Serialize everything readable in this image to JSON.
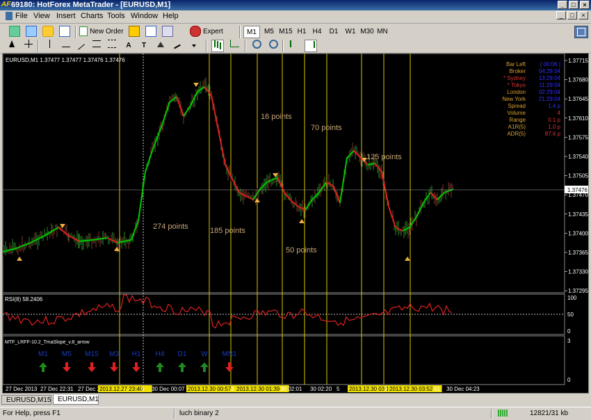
{
  "window": {
    "title": "69180: HotForex MetaTrader - [EURUSD,M1]",
    "logo": "AF",
    "btn_min": "_",
    "btn_max": "□",
    "btn_close": "×"
  },
  "menu": [
    "File",
    "View",
    "Insert",
    "Charts",
    "Tools",
    "Window",
    "Help"
  ],
  "toolbar": {
    "new_order": "New Order",
    "expert_advisors": "Expert Advisors",
    "timeframes": [
      "M1",
      "M5",
      "M15",
      "H1",
      "H4",
      "D1",
      "W1",
      "M30",
      "MN"
    ]
  },
  "drawing_tools": {
    "text": "A",
    "label": "T"
  },
  "chart": {
    "header": "EURUSD,M1  1.37477 1.37477 1.37476 1.37476",
    "current_price": "1.37476",
    "price_ticks": [
      "1.37715",
      "1.37680",
      "1.37645",
      "1.37610",
      "1.37575",
      "1.37540",
      "1.37505",
      "1.37470",
      "1.37435",
      "1.37400",
      "1.37365",
      "1.37330",
      "1.37295"
    ],
    "annotations": [
      "274 points",
      "185 points",
      "16 points",
      "50 points",
      "70 points",
      "125 points"
    ],
    "info_panel": [
      {
        "label": "Bar Left",
        "value": "[ 00:06 ]"
      },
      {
        "label": "Broker",
        "value": "04:29:04"
      },
      {
        "label": "* Sydney",
        "value": "13:29:04"
      },
      {
        "label": "* Tokyo",
        "value": "11:29:04"
      },
      {
        "label": "London",
        "value": "02:29:04"
      },
      {
        "label": "New York",
        "value": "21:29:04"
      },
      {
        "label": "Spread",
        "value": "1.4 p"
      },
      {
        "label": "Volume",
        "value": "4"
      },
      {
        "label": "Range",
        "value": "0.1 p"
      },
      {
        "label": "A1R(5)",
        "value": "1.0 p"
      },
      {
        "label": "ADR(5)",
        "value": "87.6 p"
      }
    ],
    "rsi": {
      "label": "RSI(8) 58.2406",
      "ticks": [
        "100",
        "50",
        "0"
      ]
    },
    "mtf": {
      "label": "MTF_LRFF-10.2_TmaSlope_v.8_arrow",
      "ticks": [
        "3",
        "0"
      ],
      "items": [
        {
          "tf": "M1",
          "dir": "up"
        },
        {
          "tf": "M5",
          "dir": "down"
        },
        {
          "tf": "M15",
          "dir": "down"
        },
        {
          "tf": "M3",
          "dir": "down"
        },
        {
          "tf": "H1",
          "dir": "down"
        },
        {
          "tf": "H4",
          "dir": "up"
        },
        {
          "tf": "D1",
          "dir": "up"
        },
        {
          "tf": "W",
          "dir": "up"
        },
        {
          "tf": "MN1",
          "dir": "down"
        }
      ]
    },
    "time_axis": [
      "27 Dec 2013",
      "27 Dec 22:31",
      "27 Dec 2",
      "2013.12.27 23:40",
      "5",
      "30 Dec 00:07",
      "2013.12.30 00:57",
      "3",
      "2013.12.30 01:39",
      ":30 02:01",
      "30 02:20",
      "5",
      "2013.12.30 03:10",
      "3",
      "2013.12.30 03:52",
      ":51",
      "30 Dec 04:23"
    ]
  },
  "tabs": [
    "EURUSD,M15",
    "EURUSD,M1"
  ],
  "status": {
    "help": "For Help, press F1",
    "profile": "luch binary 2",
    "traffic": "12821/31 kb"
  },
  "colors": {
    "bull": "#00c800",
    "bear": "#e02020",
    "vline": "#d8c800",
    "info_label": "#d9a030",
    "info_value": "#3030ff",
    "text_tan": "#c8a878"
  }
}
